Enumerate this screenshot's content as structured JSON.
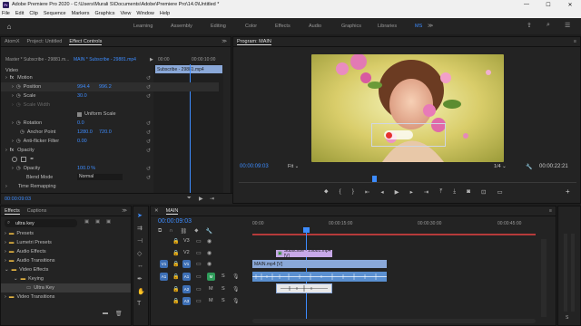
{
  "window": {
    "title": "Adobe Premiere Pro 2020 - C:\\Users\\Murali S\\Documents\\Adobe\\Premiere Pro\\14.0\\Untitled *",
    "app_icon": "Pr"
  },
  "menu": [
    "File",
    "Edit",
    "Clip",
    "Sequence",
    "Markers",
    "Graphics",
    "View",
    "Window",
    "Help"
  ],
  "workspaces": [
    "Learning",
    "Assembly",
    "Editing",
    "Color",
    "Effects",
    "Audio",
    "Graphics",
    "Libraries",
    "MS"
  ],
  "active_workspace": "MS",
  "left_panel": {
    "tabs": [
      "AtomX",
      "Project: Untitled",
      "Effect Controls"
    ],
    "active_tab": "Effect Controls",
    "master_label": "Master * Subscribe - 29881.m...",
    "sequence_label": "MAIN * Subscribe - 29881.mp4",
    "time_start": "00:00",
    "time_end": "00:00:10:00",
    "clip_label": "Subscribe - 29881.mp4",
    "section_video": "Video",
    "motion": "Motion",
    "position_label": "Position",
    "position_x": "994.4",
    "position_y": "996.2",
    "scale_label": "Scale",
    "scale_value": "30.0",
    "scale_width_label": "Scale Width",
    "uniform_scale": "Uniform Scale",
    "rotation_label": "Rotation",
    "rotation_value": "0.0",
    "anchor_label": "Anchor Point",
    "anchor_x": "1280.0",
    "anchor_y": "720.0",
    "antiflicker_label": "Anti-flicker Filter",
    "antiflicker_value": "0.00",
    "opacity_section": "Opacity",
    "opacity_label": "Opacity",
    "opacity_value": "100.0 %",
    "blend_label": "Blend Mode",
    "blend_value": "Normal",
    "time_remap": "Time Remapping",
    "timecode": "00:00:09:03"
  },
  "program": {
    "title": "Program: MAIN",
    "timecode": "00:00:09:03",
    "fit": "Fit",
    "quality": "1/4",
    "duration": "00:00:22:21"
  },
  "effects_panel": {
    "tabs": [
      "Effects",
      "Captions"
    ],
    "search_value": "ultra key",
    "items": [
      "Presets",
      "Lumetri Presets",
      "Audio Effects",
      "Audio Transitions",
      "Video Effects",
      "Keying",
      "Ultra Key",
      "Video Transitions"
    ]
  },
  "timeline": {
    "title": "MAIN",
    "timecode": "00:00:09:03",
    "ruler": [
      "00:00",
      "00:00:15:00",
      "00:00:30:00",
      "00:00:45:00"
    ],
    "tracks": [
      "V3",
      "V2",
      "V1",
      "A1",
      "A2",
      "A3"
    ],
    "clip_v2": "Subscribe - 29881.mp4 [V]",
    "clip_v1": "MAIN.mp4 [V]",
    "audio_labels": [
      "M",
      "S"
    ]
  },
  "colors": {
    "accent": "#3d8cff",
    "video_clip": "#8aa8d8",
    "subscribe_clip": "#c8a8e8",
    "audio_clip": "#5a8fd0",
    "playhead": "#3d8cff"
  }
}
